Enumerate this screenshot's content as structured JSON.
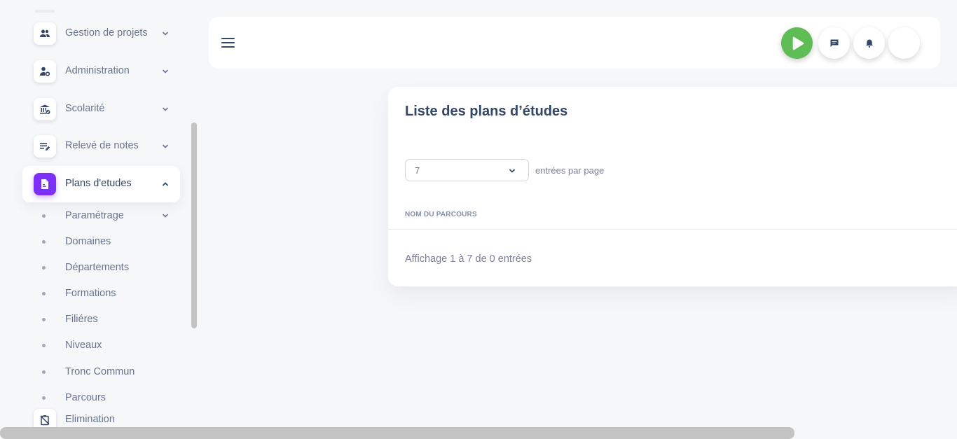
{
  "sidebar": {
    "items": [
      {
        "label": "Gestion de projets",
        "icon": "users-icon",
        "expanded": false
      },
      {
        "label": "Administration",
        "icon": "user-cog-icon",
        "expanded": false
      },
      {
        "label": "Scolarité",
        "icon": "institution-icon",
        "expanded": false
      },
      {
        "label": "Relevé de notes",
        "icon": "edit-note-icon",
        "expanded": false
      },
      {
        "label": "Plans d'etudes",
        "icon": "document-icon",
        "expanded": true
      },
      {
        "label": "Elimination",
        "icon": "clipboard-off-icon",
        "expanded": false
      }
    ],
    "subitems": [
      {
        "label": "Paramétrage",
        "has_children": true
      },
      {
        "label": "Domaines"
      },
      {
        "label": "Départements"
      },
      {
        "label": "Formations"
      },
      {
        "label": "Filiéres"
      },
      {
        "label": "Niveaux"
      },
      {
        "label": "Tronc Commun"
      },
      {
        "label": "Parcours"
      }
    ]
  },
  "navbar": {
    "menu_icon": "hamburger-icon",
    "buttons": [
      "play-icon",
      "chat-icon",
      "bell-icon",
      "avatar"
    ]
  },
  "card": {
    "title": "Liste des plans d’études",
    "page_size": "7",
    "per_page_label": "entrées par page",
    "column_header": "NOM DU PARCOURS",
    "info": "Affichage 1 à 7 de 0 entrées"
  },
  "colors": {
    "accent_purple": "#7b2ff7",
    "play_green": "#5ebd55",
    "text_dark": "#344767",
    "text_muted": "#67748e"
  }
}
